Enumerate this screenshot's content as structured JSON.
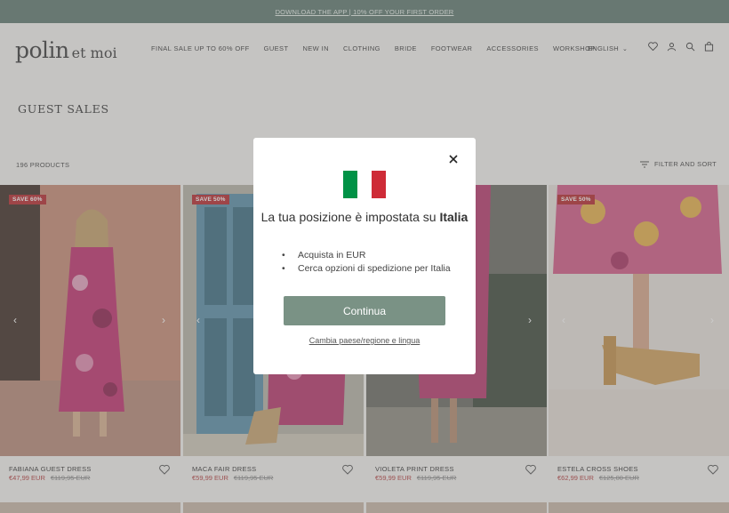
{
  "announcement": "DOWNLOAD THE APP | 10% OFF YOUR FIRST ORDER",
  "header": {
    "logo_main": "polin",
    "logo_sub": "et moi",
    "nav": [
      "FINAL SALE UP TO 60% OFF",
      "GUEST",
      "NEW IN",
      "CLOTHING",
      "BRIDE",
      "FOOTWEAR",
      "ACCESSORIES",
      "WORKSHOP"
    ],
    "language": "ENGLISH"
  },
  "page": {
    "title": "GUEST SALES",
    "count": "196 PRODUCTS",
    "filter_label": "FILTER AND SORT"
  },
  "products": [
    {
      "name": "FABIANA GUEST DRESS",
      "price": "€47,99 EUR",
      "old_price": "€119,95 EUR",
      "badge": "SAVE 60%"
    },
    {
      "name": "MACA FAIR DRESS",
      "price": "€59,99 EUR",
      "old_price": "€119,95 EUR",
      "badge": "SAVE 50%"
    },
    {
      "name": "VIOLETA PRINT DRESS",
      "price": "€59,99 EUR",
      "old_price": "€119,95 EUR",
      "badge": ""
    },
    {
      "name": "ESTELA CROSS SHOES",
      "price": "€62,99 EUR",
      "old_price": "€125,00 EUR",
      "badge": "SAVE 50%"
    }
  ],
  "modal": {
    "title_prefix": "La tua posizione è impostata su ",
    "title_country": "Italia",
    "bullets": [
      "Acquista in EUR",
      "Cerca opzioni di spedizione per Italia"
    ],
    "continue_label": "Continua",
    "change_link": "Cambia paese/regione e lingua",
    "flag_colors": [
      "#009246",
      "#ffffff",
      "#ce2b37"
    ]
  },
  "colors": {
    "announcement_bg": "#5f7a70",
    "continue_button": "#7a9285",
    "sale_badge": "#b6272d"
  }
}
